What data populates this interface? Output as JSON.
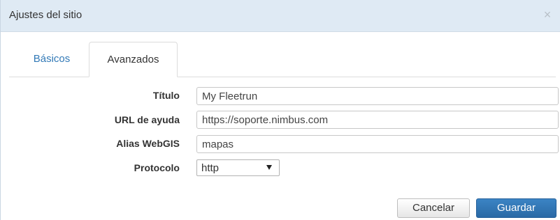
{
  "dialog": {
    "title": "Ajustes del sitio",
    "close_label": "×"
  },
  "tabs": [
    {
      "label": "Básicos",
      "active": false
    },
    {
      "label": "Avanzados",
      "active": true
    }
  ],
  "form": {
    "titulo": {
      "label": "Título",
      "value": "My Fleetrun"
    },
    "url_ayuda": {
      "label": "URL de ayuda",
      "value": "https://soporte.nimbus.com"
    },
    "alias_webgis": {
      "label": "Alias WebGIS",
      "value": "mapas"
    },
    "protocolo": {
      "label": "Protocolo",
      "value": "http"
    }
  },
  "buttons": {
    "cancel": "Cancelar",
    "save": "Guardar"
  },
  "colors": {
    "titlebar_bg": "#dfeaf4",
    "tab_link": "#337ab7",
    "primary_button": "#337ab7"
  }
}
